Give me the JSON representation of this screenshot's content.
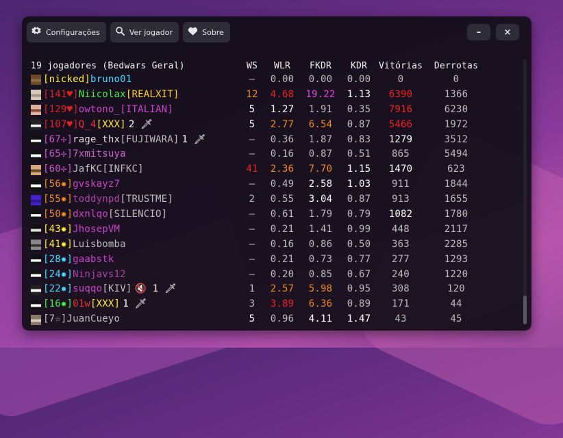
{
  "toolbar": {
    "settings_label": "Configurações",
    "view_player_label": "Ver jogador",
    "about_label": "Sobre",
    "minimize_label": "–",
    "close_label": "×"
  },
  "table": {
    "title": "19 jogadores (Bedwars Geral)",
    "columns": [
      "WS",
      "WLR",
      "FKDR",
      "KDR",
      "Vitórias",
      "Derrotas"
    ],
    "rows": [
      {
        "star": "[nicked]",
        "name": "bruno01",
        "star_color": "#ffee33",
        "name_color": "#44ddff",
        "avatar": [
          "#6b4a2a",
          "#8a6a44"
        ],
        "ws": "–",
        "wlr": "0.00",
        "fkdr": "0.00",
        "kdr": "0.00",
        "vit": "0",
        "der": "0",
        "ws_c": "#bcbcbc",
        "wlr_c": "#bcbcbc",
        "fkdr_c": "#bcbcbc",
        "kdr_c": "#bcbcbc",
        "vit_c": "#bcbcbc",
        "der_c": "#bcbcbc"
      },
      {
        "star": "[141♥]",
        "name": "Niicolax",
        "suffix": "[REALXIT]",
        "star_color": "#dd2222",
        "name_color": "#44ee44",
        "suffix_color": "#ffcc22",
        "avatar": [
          "#d8c8b8",
          "#a89888"
        ],
        "ws": "12",
        "wlr": "4.68",
        "fkdr": "19.22",
        "kdr": "1.13",
        "vit": "6390",
        "der": "1366",
        "ws_c": "#f08a1e",
        "wlr_c": "#ee2222",
        "fkdr_c": "#e040e0",
        "kdr_c": "#ffffff",
        "vit_c": "#ee2222",
        "der_c": "#bcbcbc"
      },
      {
        "star": "[129♥]",
        "name": "owtono_",
        "suffix": "[ITALIAN]",
        "star_color": "#dd2222",
        "name_color": "#cc44cc",
        "suffix_color": "#cc44cc",
        "avatar": [
          "#e0b0a0",
          "#8a4a3a"
        ],
        "ws": "5",
        "wlr": "1.27",
        "fkdr": "1.91",
        "kdr": "0.35",
        "vit": "7916",
        "der": "6230",
        "ws_c": "#ffffff",
        "wlr_c": "#ffffff",
        "fkdr_c": "#bcbcbc",
        "kdr_c": "#bcbcbc",
        "vit_c": "#ee2222",
        "der_c": "#bcbcbc"
      },
      {
        "star": "[107♥]",
        "name": "Q_4",
        "suffix": "[XXX]",
        "extra": "2 🗡",
        "star_color": "#dd2222",
        "name_color": "#ee3333",
        "suffix_color": "#ffee33",
        "avatar": [
          "#222222",
          "#ffffff"
        ],
        "ws": "5",
        "wlr": "2.77",
        "fkdr": "6.54",
        "kdr": "0.87",
        "vit": "5466",
        "der": "1972",
        "ws_c": "#ffffff",
        "wlr_c": "#f08a1e",
        "fkdr_c": "#f08a1e",
        "kdr_c": "#bcbcbc",
        "vit_c": "#ee2222",
        "der_c": "#bcbcbc"
      },
      {
        "star": "[67✢]",
        "name": "rage_thx",
        "suffix": "[FUJIWARA]",
        "extra": "1 🗡",
        "star_color": "#cc55cc",
        "name_color": "#dddddd",
        "suffix_color": "#bcbcbc",
        "avatar": [
          "#111111",
          "#ffffff"
        ],
        "ws": "–",
        "wlr": "0.36",
        "fkdr": "1.87",
        "kdr": "0.83",
        "vit": "1279",
        "der": "3512",
        "ws_c": "#bcbcbc",
        "wlr_c": "#bcbcbc",
        "fkdr_c": "#bcbcbc",
        "kdr_c": "#bcbcbc",
        "vit_c": "#ffffff",
        "der_c": "#bcbcbc"
      },
      {
        "star": "[65✢]",
        "name": "7xmitsuya",
        "star_color": "#cc55cc",
        "name_color": "#cc66cc",
        "avatar": [
          "#111111",
          "#ffffff"
        ],
        "ws": "–",
        "wlr": "0.16",
        "fkdr": "0.87",
        "kdr": "0.51",
        "vit": "865",
        "der": "5494",
        "ws_c": "#bcbcbc",
        "wlr_c": "#bcbcbc",
        "fkdr_c": "#bcbcbc",
        "kdr_c": "#bcbcbc",
        "vit_c": "#bcbcbc",
        "der_c": "#bcbcbc"
      },
      {
        "star": "[60✢]",
        "name": "JafKC",
        "suffix": "[INFKC]",
        "star_color": "#cc55cc",
        "name_color": "#bcbcbc",
        "suffix_color": "#bcbcbc",
        "avatar": [
          "#d8a878",
          "#6a4a2a"
        ],
        "ws": "41",
        "wlr": "2.36",
        "fkdr": "7.70",
        "kdr": "1.15",
        "vit": "1470",
        "der": "623",
        "ws_c": "#ee2222",
        "wlr_c": "#f08a1e",
        "fkdr_c": "#f08a1e",
        "kdr_c": "#ffffff",
        "vit_c": "#ffffff",
        "der_c": "#bcbcbc"
      },
      {
        "star": "[56✸]",
        "name": "gvskayz7",
        "star_color": "#f08a1e",
        "name_color": "#cc44cc",
        "avatar": [
          "#111111",
          "#ffffff"
        ],
        "ws": "–",
        "wlr": "0.49",
        "fkdr": "2.58",
        "kdr": "1.03",
        "vit": "911",
        "der": "1844",
        "ws_c": "#bcbcbc",
        "wlr_c": "#bcbcbc",
        "fkdr_c": "#ffffff",
        "kdr_c": "#ffffff",
        "vit_c": "#bcbcbc",
        "der_c": "#bcbcbc"
      },
      {
        "star": "[55✸]",
        "name": "toddynpd",
        "suffix": "[TRUSTME]",
        "star_color": "#f08a1e",
        "name_color": "#aa44aa",
        "suffix_color": "#bcbcbc",
        "avatar": [
          "#4422cc",
          "#2a1a88"
        ],
        "ws": "2",
        "wlr": "0.55",
        "fkdr": "3.04",
        "kdr": "0.87",
        "vit": "913",
        "der": "1655",
        "ws_c": "#bcbcbc",
        "wlr_c": "#bcbcbc",
        "fkdr_c": "#ffffff",
        "kdr_c": "#bcbcbc",
        "vit_c": "#bcbcbc",
        "der_c": "#bcbcbc"
      },
      {
        "star": "[50✸]",
        "name": "dxnlqo",
        "suffix": "[SILENCIO]",
        "star_color": "#f08a1e",
        "name_color": "#cc44cc",
        "suffix_color": "#bcbcbc",
        "avatar": [
          "#111111",
          "#ffffff"
        ],
        "ws": "–",
        "wlr": "0.61",
        "fkdr": "1.79",
        "kdr": "0.79",
        "vit": "1082",
        "der": "1780",
        "ws_c": "#bcbcbc",
        "wlr_c": "#bcbcbc",
        "fkdr_c": "#bcbcbc",
        "kdr_c": "#bcbcbc",
        "vit_c": "#ffffff",
        "der_c": "#bcbcbc"
      },
      {
        "star": "[43✸]",
        "name": "JhosepVM",
        "star_color": "#ffee33",
        "name_color": "#cc44cc",
        "avatar": [
          "#111111",
          "#e0e0e0"
        ],
        "ws": "–",
        "wlr": "0.21",
        "fkdr": "1.41",
        "kdr": "0.99",
        "vit": "448",
        "der": "2117",
        "ws_c": "#bcbcbc",
        "wlr_c": "#bcbcbc",
        "fkdr_c": "#bcbcbc",
        "kdr_c": "#bcbcbc",
        "vit_c": "#bcbcbc",
        "der_c": "#bcbcbc"
      },
      {
        "star": "[41✸]",
        "name": "Luisbomba",
        "star_color": "#ffee33",
        "name_color": "#bcbcbc",
        "avatar": [
          "#888888",
          "#333333"
        ],
        "ws": "–",
        "wlr": "0.16",
        "fkdr": "0.86",
        "kdr": "0.50",
        "vit": "363",
        "der": "2285",
        "ws_c": "#bcbcbc",
        "wlr_c": "#bcbcbc",
        "fkdr_c": "#bcbcbc",
        "kdr_c": "#bcbcbc",
        "vit_c": "#bcbcbc",
        "der_c": "#bcbcbc"
      },
      {
        "star": "[28✸]",
        "name": "gaabstk",
        "star_color": "#44ddff",
        "name_color": "#cc44cc",
        "avatar": [
          "#111111",
          "#ffffff"
        ],
        "ws": "–",
        "wlr": "0.21",
        "fkdr": "0.73",
        "kdr": "0.77",
        "vit": "277",
        "der": "1293",
        "ws_c": "#bcbcbc",
        "wlr_c": "#bcbcbc",
        "fkdr_c": "#bcbcbc",
        "kdr_c": "#bcbcbc",
        "vit_c": "#bcbcbc",
        "der_c": "#bcbcbc"
      },
      {
        "star": "[24✸]",
        "name": "Ninjavs12",
        "star_color": "#44ddff",
        "name_color": "#aa44aa",
        "avatar": [
          "#111111",
          "#ffffff"
        ],
        "ws": "–",
        "wlr": "0.20",
        "fkdr": "0.85",
        "kdr": "0.67",
        "vit": "240",
        "der": "1220",
        "ws_c": "#bcbcbc",
        "wlr_c": "#bcbcbc",
        "fkdr_c": "#bcbcbc",
        "kdr_c": "#bcbcbc",
        "vit_c": "#bcbcbc",
        "der_c": "#bcbcbc"
      },
      {
        "star": "[22✸]",
        "name": "suqqo",
        "suffix": "[KIV]",
        "extra": "🔇 1 🗡",
        "star_color": "#44ddff",
        "name_color": "#cc44cc",
        "suffix_color": "#bcbcbc",
        "avatar": [
          "#222222",
          "#ffffff"
        ],
        "ws": "1",
        "wlr": "2.57",
        "fkdr": "5.98",
        "kdr": "0.95",
        "vit": "308",
        "der": "120",
        "ws_c": "#bcbcbc",
        "wlr_c": "#f08a1e",
        "fkdr_c": "#f08a1e",
        "kdr_c": "#bcbcbc",
        "vit_c": "#bcbcbc",
        "der_c": "#bcbcbc"
      },
      {
        "star": "[16✸]",
        "name": "01w",
        "suffix": "[XXX]",
        "extra": "1 🗡",
        "star_color": "#44ee44",
        "name_color": "#ee3333",
        "suffix_color": "#ffee33",
        "avatar": [
          "#111111",
          "#ffffff"
        ],
        "ws": "3",
        "wlr": "3.89",
        "fkdr": "6.36",
        "kdr": "0.89",
        "vit": "171",
        "der": "44",
        "ws_c": "#bcbcbc",
        "wlr_c": "#ee2222",
        "fkdr_c": "#f08a1e",
        "kdr_c": "#bcbcbc",
        "vit_c": "#bcbcbc",
        "der_c": "#bcbcbc"
      },
      {
        "star": "[7☆]",
        "name": "JuanCueyo",
        "star_color": "#bcbcbc",
        "name_color": "#bcbcbc",
        "avatar": [
          "#8a7a6a",
          "#d8c8b8"
        ],
        "ws": "5",
        "wlr": "0.96",
        "fkdr": "4.11",
        "kdr": "1.47",
        "vit": "43",
        "der": "45",
        "ws_c": "#ffffff",
        "wlr_c": "#bcbcbc",
        "fkdr_c": "#ffffff",
        "kdr_c": "#ffffff",
        "vit_c": "#bcbcbc",
        "der_c": "#bcbcbc"
      }
    ]
  }
}
